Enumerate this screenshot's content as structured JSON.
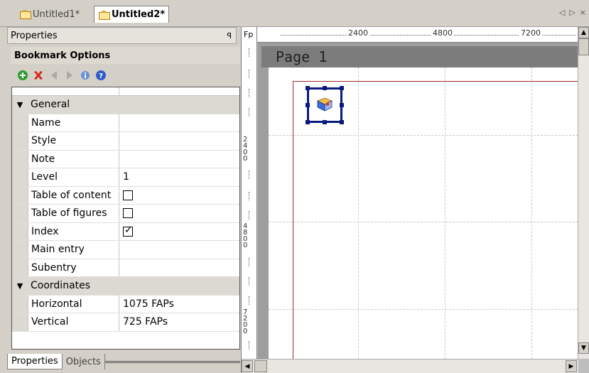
{
  "tabs": [
    {
      "label": "Untitled1*",
      "active": false
    },
    {
      "label": "Untitled2*",
      "active": true
    }
  ],
  "tab_nav": {
    "prev": "◁",
    "next": "▷",
    "close": "×"
  },
  "properties": {
    "title": "Properties",
    "section": "Bookmark Options",
    "groups": [
      {
        "name": "General",
        "rows": [
          {
            "name": "Name",
            "value": ""
          },
          {
            "name": "Style",
            "value": ""
          },
          {
            "name": "Note",
            "value": ""
          },
          {
            "name": "Level",
            "value": "1"
          },
          {
            "name": "Table of content",
            "checkbox": false
          },
          {
            "name": "Table of figures",
            "checkbox": false
          },
          {
            "name": "Index",
            "checkbox": true
          },
          {
            "name": "Main entry",
            "value": ""
          },
          {
            "name": "Subentry",
            "value": ""
          }
        ]
      },
      {
        "name": "Coordinates",
        "rows": [
          {
            "name": "Horizontal",
            "value": "1075 FAPs"
          },
          {
            "name": "Vertical",
            "value": "725 FAPs"
          }
        ]
      }
    ],
    "bottom_tabs": [
      "Properties",
      "Objects"
    ]
  },
  "designer": {
    "ruler_corner": "Fp",
    "ruler_top_labels": [
      "2400",
      "4800",
      "7200"
    ],
    "ruler_left_labels": [
      "2400",
      "4800",
      "7200"
    ],
    "page_label": "Page 1"
  },
  "colors": {
    "selection": "#0a1a80",
    "margin_line": "#9b2a2a",
    "page_header": "#7c7c7c"
  }
}
